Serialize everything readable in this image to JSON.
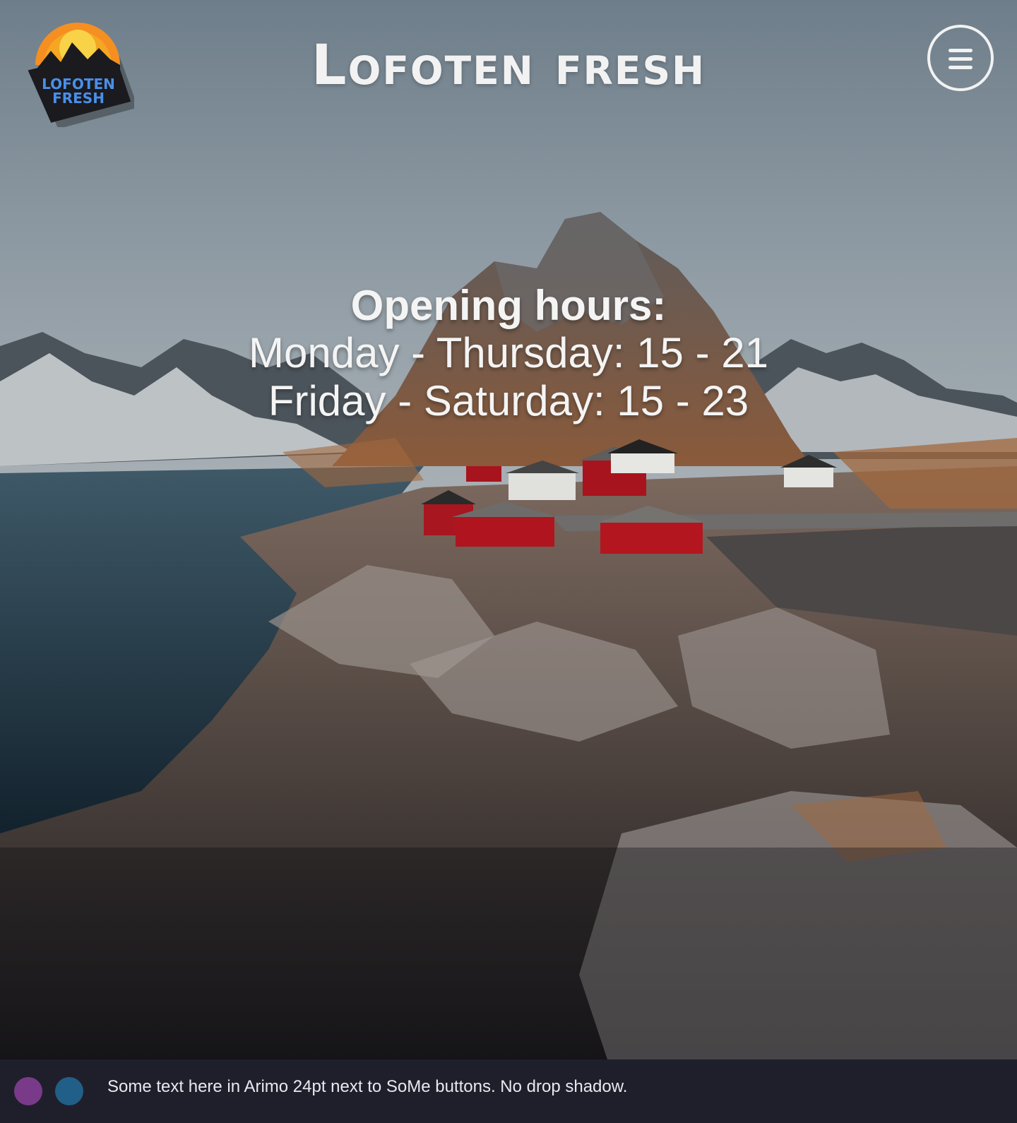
{
  "header": {
    "logo_text_line1": "LOFOTEN",
    "logo_text_line2": "FRESH",
    "title": "Lofoten fresh"
  },
  "icons": {
    "menu": "hamburger-icon",
    "logo": "mountain-sun-logo"
  },
  "hours": {
    "heading": "Opening hours:",
    "weekdays": "Monday - Thursday: 15 - 21",
    "weekend": "Friday - Saturday: 15 - 23"
  },
  "footer": {
    "text": "Some text here in Arimo 24pt next to SoMe buttons. No drop shadow.",
    "buttons": [
      {
        "color": "#7a3a8a"
      },
      {
        "color": "#215f88"
      }
    ]
  },
  "colors": {
    "footer_bg": "#1f1f2c",
    "logo_text": "#4a8fe8",
    "logo_sun": "#f5a623",
    "title": "#f2f2f2"
  }
}
